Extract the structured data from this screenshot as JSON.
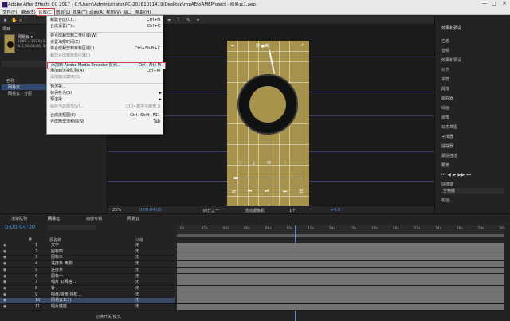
{
  "window": {
    "title": "Adobe After Effects CC 2017 - C:\\Users\\Administrator.PC-20161011419\\Desktop\\mpAEtoAMEProject - 网易云1.aep",
    "min_btn": "—",
    "max_btn": "□",
    "close_btn": "✕"
  },
  "menubar": [
    "文件(F)",
    "编辑(E)",
    "合成(C)",
    "图层(L)",
    "效果(T)",
    "动画(A)",
    "视图(V)",
    "窗口",
    "帮助(H)"
  ],
  "composition_menu": {
    "items": [
      {
        "label": "新建合成(C)...",
        "shortcut": "Ctrl+N",
        "disabled": false
      },
      {
        "label": "合成设置(T)...",
        "shortcut": "Ctrl+K",
        "disabled": false
      },
      {
        "label": "将合成裁剪到工作区域(W)",
        "shortcut": "",
        "disabled": false
      },
      {
        "label": "设置海报时间(E)",
        "shortcut": "",
        "disabled": false
      },
      {
        "label": "将合成裁剪到目标区域(I)",
        "shortcut": "Ctrl+Shift+X",
        "disabled": false
      },
      {
        "label": "裁剪合成到目标区域(I)",
        "shortcut": "",
        "disabled": true
      },
      {
        "label": "添加到 Adobe Media Encoder 队列...",
        "shortcut": "Ctrl+Alt+M",
        "disabled": false,
        "highlight": true
      },
      {
        "label": "添加到渲染队列(A)",
        "shortcut": "Ctrl+M",
        "disabled": false
      },
      {
        "label": "添加输出模块(D)",
        "shortcut": "",
        "disabled": true
      },
      {
        "label": "预渲染...",
        "shortcut": "",
        "disabled": false
      },
      {
        "label": "帧另存为(S)",
        "shortcut": "",
        "disabled": false,
        "submenu": true
      },
      {
        "label": "预渲染...",
        "shortcut": "",
        "disabled": false,
        "submenu": true
      },
      {
        "label": "保存当前预览(V)...",
        "shortcut": "Ctrl+数字小键盘 0",
        "disabled": true
      },
      {
        "label": "合成流程图(F)",
        "shortcut": "Ctrl+Shift+F11",
        "disabled": false
      },
      {
        "label": "合成微型流程图(N)",
        "shortcut": "Tab",
        "disabled": false
      }
    ]
  },
  "project_panel": {
    "tab": "项目",
    "comp_name": "网易云 ▾",
    "comp_info": "1080 x 1920 (1.00)",
    "comp_info2": "Δ 0;00;04;00, 29.97 fps",
    "col_name": "名称",
    "items": [
      "网易云",
      "网易云 - 分层"
    ]
  },
  "viewer": {
    "header_title": "野 ●曲",
    "zoom": "25%",
    "time": "0;00;04;00",
    "resolution": "四分之一",
    "camera": "活动摄像机",
    "view": "1个",
    "offset": "+0.0"
  },
  "right_panel": {
    "header": "效果和预设",
    "items": [
      "信息",
      "音频",
      "效果和预设",
      "对齐",
      "字符",
      "段落",
      "跟踪器",
      "绘画",
      "画笔",
      "动态草图",
      "平滑器",
      "摇摆器",
      "蒙版插值",
      "预览"
    ],
    "shortcut_label": "快捷键",
    "shortcut_value": "空格键",
    "include_label": "包括:"
  },
  "timeline": {
    "tabs": [
      "渲染队列",
      "网易云",
      "动感专辑",
      "网易云"
    ],
    "current_time": "0;00;04;00",
    "cols": {
      "num": "#",
      "source": "源名称",
      "parent": "父级"
    },
    "layers": [
      {
        "n": "1",
        "name": "文字",
        "parent": "无"
      },
      {
        "n": "2",
        "name": "图标四",
        "parent": "无"
      },
      {
        "n": "3",
        "name": "图标三",
        "parent": "无"
      },
      {
        "n": "4",
        "name": "进度条 两侧",
        "parent": "无"
      },
      {
        "n": "5",
        "name": "进度条",
        "parent": "无"
      },
      {
        "n": "6",
        "name": "图标一",
        "parent": "无"
      },
      {
        "n": "7",
        "name": "唱片 1/网格...",
        "parent": "无"
      },
      {
        "n": "8",
        "name": "针",
        "parent": "无"
      },
      {
        "n": "9",
        "name": "唱盘/转盘 外框...",
        "parent": "无"
      },
      {
        "n": "10",
        "name": "网易云1(3)",
        "parent": "无"
      },
      {
        "n": "11",
        "name": "唱片底座",
        "parent": "无"
      }
    ],
    "ruler": [
      "0s",
      "02s",
      "04s",
      "06s",
      "08s",
      "10s",
      "12s",
      "14s",
      "16s",
      "18s",
      "20s",
      "22s",
      "24s",
      "26s",
      "28s",
      "30s"
    ],
    "footer": "切换开关/模式"
  },
  "colors": {
    "accent": "#d24040",
    "phone_bg": "#a6924a",
    "time_blue": "#4f8ed8",
    "guide": "#3d3d7a"
  }
}
